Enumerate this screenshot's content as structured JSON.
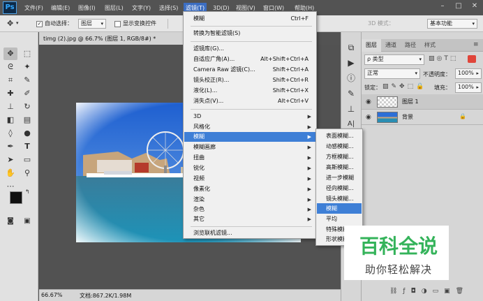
{
  "app": {
    "logo": "Ps"
  },
  "menubar": {
    "items": [
      "文件(F)",
      "编辑(E)",
      "图像(I)",
      "图层(L)",
      "文字(Y)",
      "选择(S)",
      "滤镜(T)",
      "3D(D)",
      "视图(V)",
      "窗口(W)",
      "帮助(H)"
    ],
    "active_index": 6,
    "window_buttons": [
      "–",
      "□",
      "✕"
    ]
  },
  "options": {
    "auto_select_label": "自动选择：",
    "auto_select_value": "图层",
    "show_transform_label": "显示变换控件",
    "mode_3d_label": "3D 模式：",
    "workspace_value": "基本功能"
  },
  "document": {
    "tab_title": "timg (2).jpg @ 66.7% (图层 1, RGB/8#) *",
    "tab_close": "×",
    "zoom": "66.67%",
    "doc_info": "文档:867.2K/1.98M"
  },
  "filter_menu": {
    "top_items": [
      {
        "label": "模糊",
        "shortcut": "Ctrl+F"
      },
      {
        "label": "转换为智能滤镜(S)",
        "shortcut": ""
      }
    ],
    "gallery_items": [
      {
        "label": "滤镜库(G)...",
        "shortcut": ""
      },
      {
        "label": "自适应广角(A)...",
        "shortcut": "Alt+Shift+Ctrl+A"
      },
      {
        "label": "Camera Raw 滤镜(C)...",
        "shortcut": "Shift+Ctrl+A"
      },
      {
        "label": "镜头校正(R)...",
        "shortcut": "Shift+Ctrl+R"
      },
      {
        "label": "液化(L)...",
        "shortcut": "Shift+Ctrl+X"
      },
      {
        "label": "消失点(V)...",
        "shortcut": "Alt+Ctrl+V"
      }
    ],
    "submenu_items": [
      "3D",
      "风格化",
      "模糊",
      "模糊画廊",
      "扭曲",
      "锐化",
      "视频",
      "像素化",
      "渲染",
      "杂色",
      "其它"
    ],
    "highlighted_submenu": "模糊",
    "browse_label": "浏览联机滤镜..."
  },
  "blur_submenu": {
    "items": [
      "表面模糊...",
      "动感模糊...",
      "方框模糊...",
      "高斯模糊...",
      "进一步模糊",
      "径向模糊...",
      "镜头模糊...",
      "模糊",
      "平均",
      "特殊模糊...",
      "形状模糊..."
    ],
    "highlighted": "模糊"
  },
  "layers_panel": {
    "tabs": [
      "图层",
      "通道",
      "路径",
      "样式"
    ],
    "kind_filter": "ρ 类型",
    "blend_mode": "正常",
    "opacity_label": "不透明度：",
    "opacity_value": "100%",
    "lock_label": "锁定：",
    "fill_label": "填充：",
    "fill_value": "100%",
    "layers": [
      {
        "name": "图层 1",
        "active": true
      },
      {
        "name": "背景",
        "active": false,
        "locked": true
      }
    ]
  },
  "watermark": {
    "title": "百科全说",
    "subtitle": "助你轻松解决"
  }
}
